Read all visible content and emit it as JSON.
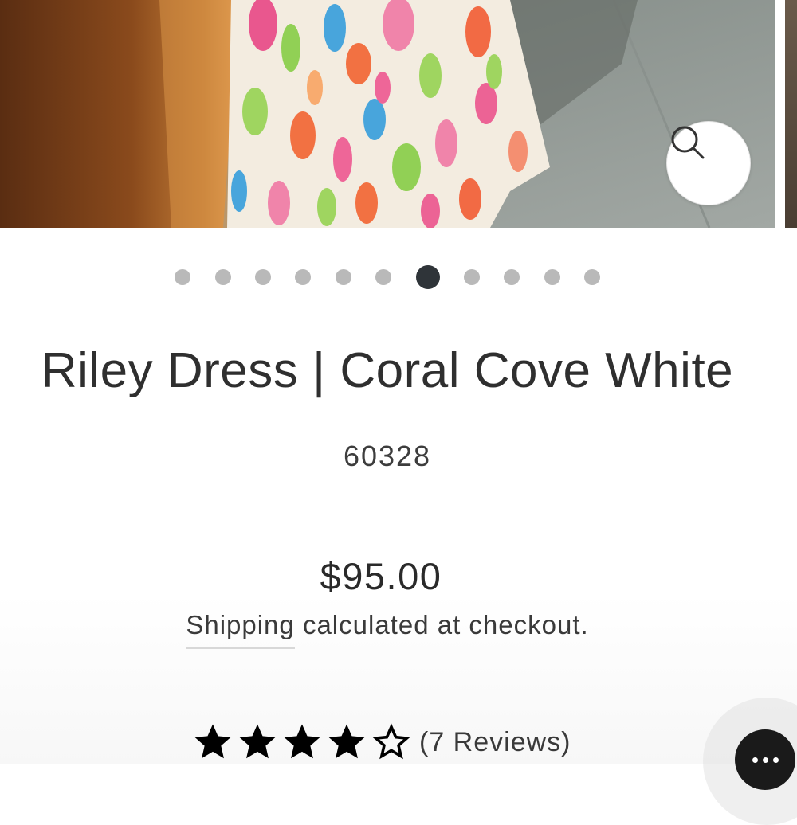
{
  "product": {
    "title": "Riley Dress | Coral Cove White",
    "sku": "60328",
    "price": "$95.00",
    "shipping_link": "Shipping",
    "shipping_rest": " calculated at checkout.",
    "rating": {
      "stars": 4,
      "max_stars": 5,
      "reviews_label": "(7 Reviews)"
    }
  },
  "gallery": {
    "total_slides": 11,
    "active_slide": 7,
    "zoom_icon": "magnifier-icon"
  },
  "chat": {
    "icon": "ellipsis-chat-icon"
  },
  "colors": {
    "dot_inactive": "#b9b9b9",
    "dot_active": "#2f3439",
    "chat_button": "#1a1a1a"
  }
}
